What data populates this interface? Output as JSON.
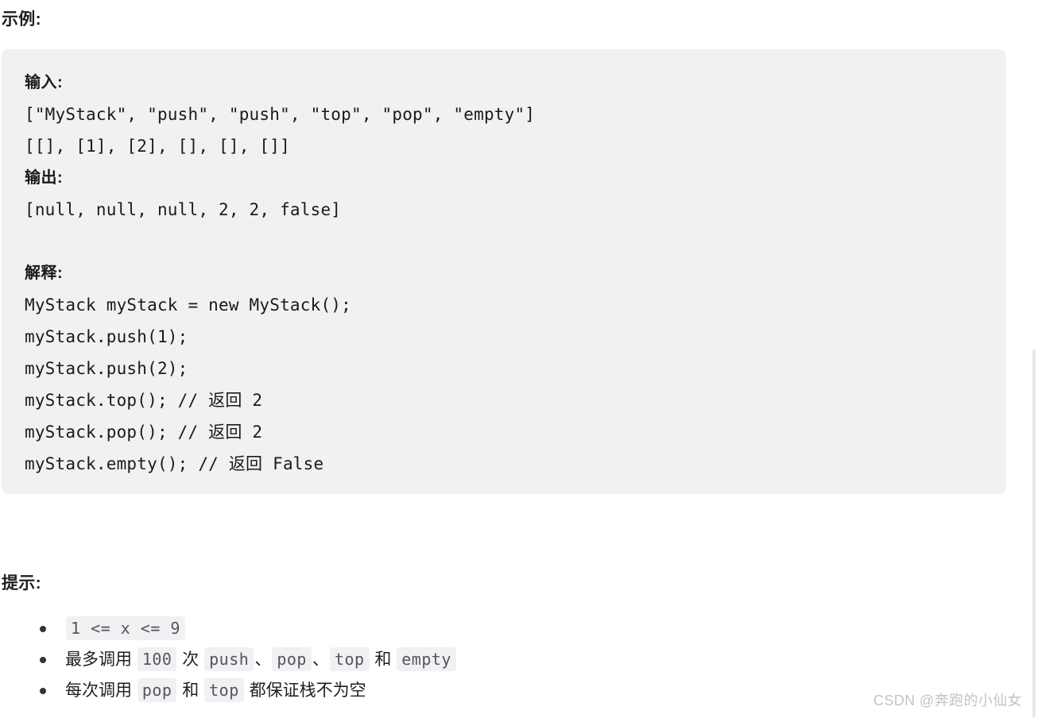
{
  "headings": {
    "example": "示例:",
    "hints": "提示:"
  },
  "code_block": {
    "lines": [
      {
        "type": "label",
        "text": "输入:"
      },
      {
        "type": "code",
        "text": "[\"MyStack\", \"push\", \"push\", \"top\", \"pop\", \"empty\"]"
      },
      {
        "type": "code",
        "text": "[[], [1], [2], [], [], []]"
      },
      {
        "type": "label",
        "text": "输出:"
      },
      {
        "type": "code",
        "text": "[null, null, null, 2, 2, false]"
      },
      {
        "type": "blank",
        "text": ""
      },
      {
        "type": "label",
        "text": "解释:"
      },
      {
        "type": "code",
        "text": "MyStack myStack = new MyStack();"
      },
      {
        "type": "code",
        "text": "myStack.push(1);"
      },
      {
        "type": "code",
        "text": "myStack.push(2);"
      },
      {
        "type": "code",
        "text": "myStack.top(); // 返回 2"
      },
      {
        "type": "code",
        "text": "myStack.pop(); // 返回 2"
      },
      {
        "type": "code",
        "text": "myStack.empty(); // 返回 False"
      }
    ]
  },
  "hints": {
    "items": [
      {
        "segments": [
          {
            "kind": "code",
            "text": "1 <= x <= 9"
          }
        ]
      },
      {
        "segments": [
          {
            "kind": "text",
            "text": "最多调用 "
          },
          {
            "kind": "code",
            "text": "100"
          },
          {
            "kind": "text",
            "text": " 次 "
          },
          {
            "kind": "code",
            "text": "push"
          },
          {
            "kind": "text",
            "text": "、"
          },
          {
            "kind": "code",
            "text": "pop"
          },
          {
            "kind": "text",
            "text": "、"
          },
          {
            "kind": "code",
            "text": "top"
          },
          {
            "kind": "text",
            "text": " 和 "
          },
          {
            "kind": "code",
            "text": "empty"
          }
        ]
      },
      {
        "segments": [
          {
            "kind": "text",
            "text": "每次调用 "
          },
          {
            "kind": "code",
            "text": "pop"
          },
          {
            "kind": "text",
            "text": " 和 "
          },
          {
            "kind": "code",
            "text": "top"
          },
          {
            "kind": "text",
            "text": " 都保证栈不为空"
          }
        ]
      }
    ]
  },
  "watermark": {
    "text": "CSDN @奔跑的小仙女"
  },
  "colors": {
    "page_background": "#ffffff",
    "code_block_background": "#f0f1f3",
    "inline_code_background": "#f0f1f3",
    "inline_code_text": "#55555c",
    "body_text": "#1f1f23",
    "watermark_text": "#c3c3c8",
    "scrollbar_track": "#e9e9ec"
  }
}
